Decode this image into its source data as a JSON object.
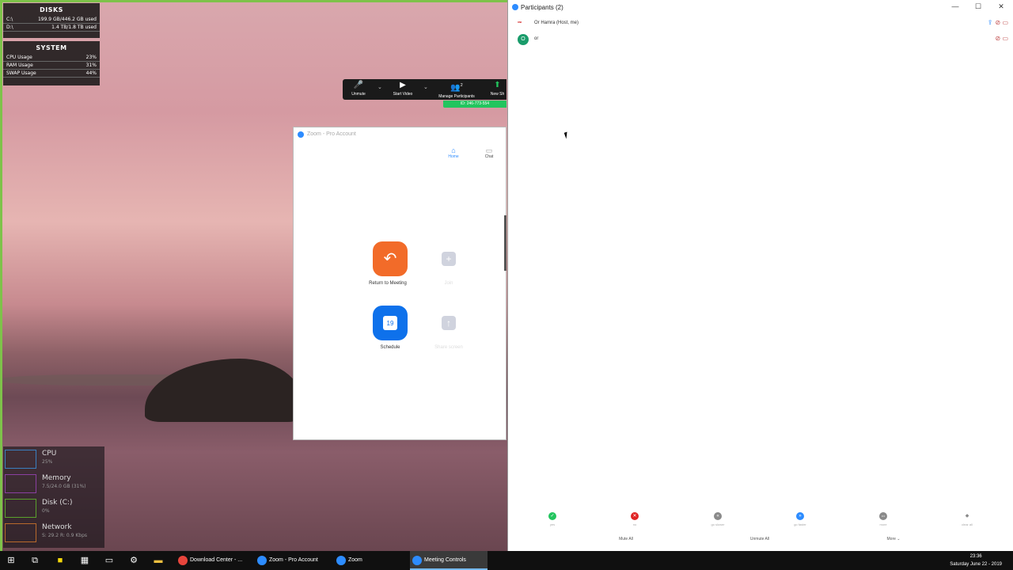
{
  "disks": {
    "title": "DISKS",
    "rows": [
      {
        "label": "C:\\",
        "value": "199.9 GB/446.2 GB used"
      },
      {
        "label": "D:\\",
        "value": "1.4 TB/1.8 TB used"
      }
    ]
  },
  "system": {
    "title": "SYSTEM",
    "rows": [
      {
        "label": "CPU Usage",
        "value": "23%"
      },
      {
        "label": "RAM Usage",
        "value": "31%"
      },
      {
        "label": "SWAP Usage",
        "value": "44%"
      }
    ]
  },
  "perf": [
    {
      "name": "CPU",
      "value": "25%",
      "color": "#3a7fbf"
    },
    {
      "name": "Memory",
      "value": "7.5/24.0 GB (31%)",
      "color": "#8a3fa0"
    },
    {
      "name": "Disk (C:)",
      "value": "0%",
      "color": "#5aa02c"
    },
    {
      "name": "Network",
      "value": "S: 29.2  R: 0.9 Kbps",
      "color": "#b8692b"
    }
  ],
  "meeting_bar": {
    "unmute": "Unmute",
    "start_video": "Start Video",
    "manage_participants": "Manage Participants",
    "participant_count": "2",
    "new_share": "New Sh",
    "meeting_id": "ID: 246-773-554"
  },
  "zoom_window": {
    "title": "Zoom - Pro Account",
    "tabs": {
      "home": "Home",
      "chat": "Chat"
    },
    "tiles": {
      "return": "Return to Meeting",
      "join": "Join",
      "schedule": "Schedule",
      "share": "Share screen",
      "calendar_day": "19"
    }
  },
  "participants": {
    "title": "Participants (2)",
    "list": [
      {
        "name": "Or Hamra (Host, me)",
        "avatar": "UNI",
        "initial": ""
      },
      {
        "name": "or",
        "avatar": "",
        "initial": "O"
      }
    ],
    "reactions": [
      {
        "label": "yes",
        "color": "#22c55e",
        "glyph": "✓"
      },
      {
        "label": "no",
        "color": "#e02424",
        "glyph": "✕"
      },
      {
        "label": "go slower",
        "color": "#8a8a8a",
        "glyph": "«"
      },
      {
        "label": "go faster",
        "color": "#2d8cff",
        "glyph": "»"
      },
      {
        "label": "more",
        "color": "#8a8a8a",
        "glyph": "•••"
      },
      {
        "label": "clear all",
        "color": "#8a8a8a",
        "glyph": "◆"
      }
    ],
    "buttons": {
      "mute_all": "Mute All",
      "unmute_all": "Unmute All",
      "more": "More ⌄"
    }
  },
  "taskbar": {
    "apps": [
      {
        "label": "Download Center - ...",
        "color": "#e8453c",
        "active": false
      },
      {
        "label": "Zoom - Pro Account",
        "color": "#2d8cff",
        "active": false
      },
      {
        "label": "Zoom",
        "color": "#2d8cff",
        "active": false
      },
      {
        "label": "Meeting Controls",
        "color": "#2d8cff",
        "active": true
      }
    ],
    "time": "23:36",
    "date": "Saturday  June 22 - 2019"
  }
}
